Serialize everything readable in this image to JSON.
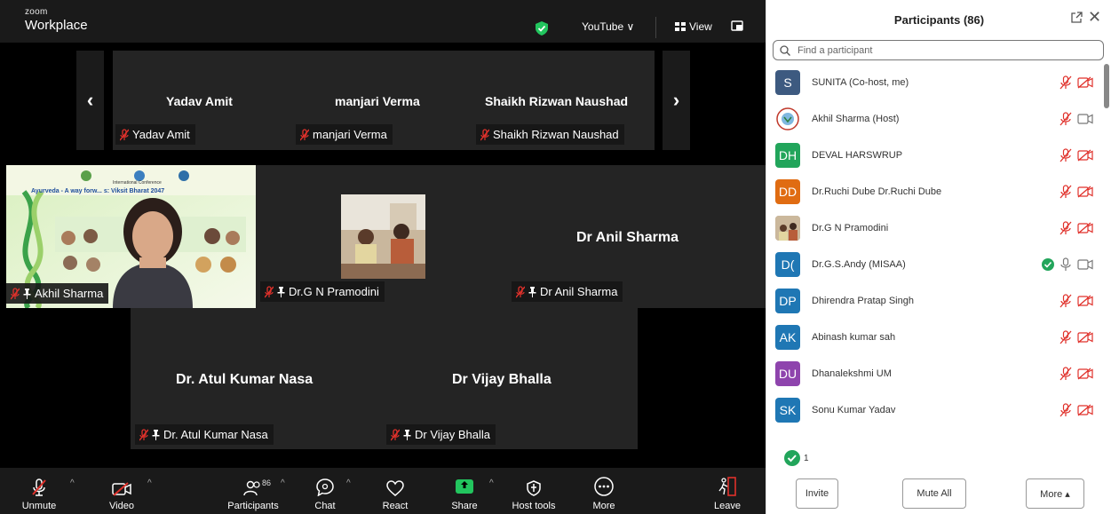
{
  "app": {
    "logo_line1": "zoom",
    "logo_line2": "Workplace"
  },
  "topbar": {
    "stream_label": "YouTube ∨",
    "view_label": "View"
  },
  "gallery": {
    "strip_tiles": [
      {
        "display_name": "Yadav Amit",
        "name_tag": "Yadav Amit"
      },
      {
        "display_name": "manjari Verma",
        "name_tag": "manjari Verma"
      },
      {
        "display_name": "Shaikh Rizwan Naushad",
        "name_tag": "Shaikh Rizwan Naushad"
      }
    ],
    "main_tiles": [
      {
        "name_tag": "Akhil Sharma",
        "banner_title": "Ayurveda - A way forw... s: Viksit Bharat 2047",
        "banner_small": "International Conference"
      },
      {
        "name_tag": "Dr.G N Pramodini"
      },
      {
        "display_name": "Dr Anil Sharma",
        "name_tag": "Dr Anil Sharma"
      },
      {
        "display_name": "Dr. Atul Kumar Nasa",
        "name_tag": "Dr. Atul Kumar Nasa"
      },
      {
        "display_name": "Dr Vijay Bhalla",
        "name_tag": "Dr Vijay Bhalla"
      }
    ]
  },
  "controls": {
    "unmute": "Unmute",
    "video": "Video",
    "participants": "Participants",
    "participants_count": "86",
    "chat": "Chat",
    "react": "React",
    "share": "Share",
    "host_tools": "Host tools",
    "more": "More",
    "leave": "Leave"
  },
  "panel": {
    "title": "Participants (86)",
    "search_placeholder": "Find a participant",
    "participants": [
      {
        "initials": "S",
        "name": "SUNITA (Co-host, me)",
        "color": "#3d5a80",
        "mic": "muted",
        "video": "off"
      },
      {
        "initials": "",
        "name": "Akhil Sharma (Host)",
        "color": "#ffffff",
        "mic": "muted",
        "video": "on",
        "icon": "logo-avatar"
      },
      {
        "initials": "DH",
        "name": "DEVAL HARSWRUP",
        "color": "#22a55b",
        "mic": "muted",
        "video": "off"
      },
      {
        "initials": "DD",
        "name": "Dr.Ruchi Dube Dr.Ruchi Dube",
        "color": "#e06c12",
        "mic": "muted",
        "video": "off"
      },
      {
        "initials": "",
        "name": "Dr.G N Pramodini",
        "color": "#b9a58c",
        "mic": "muted",
        "video": "off",
        "icon": "photo-avatar"
      },
      {
        "initials": "D(",
        "name": "Dr.G.S.Andy (MISAA)",
        "color": "#1f77b4",
        "mic": "on",
        "video": "on",
        "check": true
      },
      {
        "initials": "DP",
        "name": "Dhirendra Pratap Singh",
        "color": "#1f77b4",
        "mic": "muted",
        "video": "off"
      },
      {
        "initials": "AK",
        "name": "Abinash kumar sah",
        "color": "#1f77b4",
        "mic": "muted",
        "video": "off"
      },
      {
        "initials": "DU",
        "name": "Dhanalekshmi UM",
        "color": "#8e44ad",
        "mic": "muted",
        "video": "off"
      },
      {
        "initials": "SK",
        "name": "Sonu Kumar Yadav",
        "color": "#1f77b4",
        "mic": "muted",
        "video": "off"
      }
    ],
    "raised_count": "1",
    "invite": "Invite",
    "mute_all": "Mute All",
    "more": "More ▴"
  },
  "colors": {
    "muted_red": "#e0312b",
    "panel_bg": "#ffffff",
    "tile_bg": "#242424",
    "accent_green": "#22c55e"
  }
}
